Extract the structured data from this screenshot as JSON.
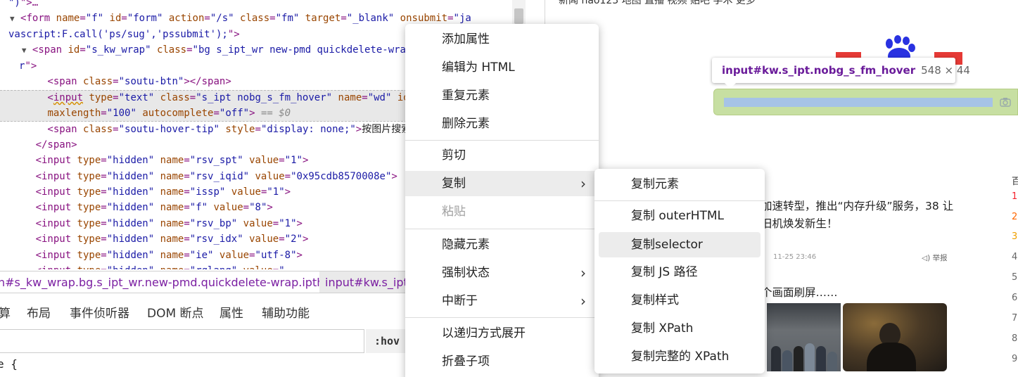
{
  "code_lines": [
    {
      "html": "<span class=\"av\">\")</span>\">…</a></span>"
    },
    {
      "html": "<span class=\"tri\">▼</span> &lt;form <span class=\"an\">name</span>=<span class=\"av\">\"f\"</span> <span class=\"an\">id</span>=<span class=\"av\">\"form\"</span> <span class=\"an\">action</span>=<span class=\"av\">\"/s\"</span> <span class=\"an\">class</span>=<span class=\"av\">\"fm\"</span> <span class=\"an\">target</span>=<span class=\"av\">\"_blank\"</span> <span class=\"an\">onsubmit</span>=<span class=\"av\">\"ja</span>"
    },
    {
      "html": "<span class=\"av\">vascript:F.call('ps/sug','pssubmit');</span>\">"
    },
    {
      "html": "  <span class=\"tri\">▼</span> &lt;span <span class=\"an\">id</span>=<span class=\"av\">\"s_kw_wrap\"</span> <span class=\"an\">class</span>=<span class=\"av\">\"bg s_ipt_wr new-pmd quickdelete-wrap ipthove</span>"
    },
    {
      "html": "<span class=\"av\">r</span>\">"
    },
    {
      "html": "        &lt;span <span class=\"an\">class</span>=<span class=\"av\">\"soutu-btn\"</span>&gt;&lt;/span&gt;"
    },
    {
      "html": "        &lt;<span class=\"sq\">input</span> <span class=\"an\">type</span>=<span class=\"av\">\"text\"</span> <span class=\"an\">class</span>=<span class=\"av\">\"s_ipt nobg_s_fm_hover\"</span> <span class=\"an\">name</span>=<span class=\"av\">\"wd\"</span> <span class=\"an\">id</span>=<span class=\"av\">\"kw\"</span>"
    },
    {
      "html": "        <span class=\"an\">maxlength</span>=<span class=\"av\">\"100\"</span> <span class=\"an\">autocomplete</span>=<span class=\"av\">\"off\"</span>&gt; <span class=\"dv\">== $0</span>"
    },
    {
      "html": "        &lt;span <span class=\"an\">class</span>=<span class=\"av\">\"soutu-hover-tip\"</span> <span class=\"an\">style</span>=<span class=\"av\">\"display: none;\"</span>&gt;<span class=\"tx\">按图片搜索</span>&lt;/span&gt;"
    },
    {
      "html": "      &lt;/span&gt;"
    },
    {
      "html": "      &lt;input <span class=\"an\">type</span>=<span class=\"av\">\"hidden\"</span> <span class=\"an\">name</span>=<span class=\"av\">\"rsv_spt\"</span> <span class=\"an\">value</span>=<span class=\"av\">\"1\"</span>&gt;"
    },
    {
      "html": "      &lt;input <span class=\"an\">type</span>=<span class=\"av\">\"hidden\"</span> <span class=\"an\">name</span>=<span class=\"av\">\"rsv_iqid\"</span> <span class=\"an\">value</span>=<span class=\"av\">\"0x95cdb8570008e\"</span>&gt;"
    },
    {
      "html": "      &lt;input <span class=\"an\">type</span>=<span class=\"av\">\"hidden\"</span> <span class=\"an\">name</span>=<span class=\"av\">\"issp\"</span> <span class=\"an\">value</span>=<span class=\"av\">\"1\"</span>&gt;"
    },
    {
      "html": "      &lt;input <span class=\"an\">type</span>=<span class=\"av\">\"hidden\"</span> <span class=\"an\">name</span>=<span class=\"av\">\"f\"</span> <span class=\"an\">value</span>=<span class=\"av\">\"8\"</span>&gt;"
    },
    {
      "html": "      &lt;input <span class=\"an\">type</span>=<span class=\"av\">\"hidden\"</span> <span class=\"an\">name</span>=<span class=\"av\">\"rsv_bp\"</span> <span class=\"an\">value</span>=<span class=\"av\">\"1\"</span>&gt;"
    },
    {
      "html": "      &lt;input <span class=\"an\">type</span>=<span class=\"av\">\"hidden\"</span> <span class=\"an\">name</span>=<span class=\"av\">\"rsv_idx\"</span> <span class=\"an\">value</span>=<span class=\"av\">\"2\"</span>&gt;"
    },
    {
      "html": "      &lt;input <span class=\"an\">type</span>=<span class=\"av\">\"hidden\"</span> <span class=\"an\">name</span>=<span class=\"av\">\"ie\"</span> <span class=\"an\">value</span>=<span class=\"av\">\"utf-8\"</span>&gt;"
    },
    {
      "html": "      &lt;input <span class=\"an\">type</span>=<span class=\"av\">\"hidden\"</span> <span class=\"an\">name</span>=<span class=\"av\">\"rqlang\"</span> <span class=\"an\">value</span>=<span class=\"av\">\"</span>"
    }
  ],
  "breadcrumb": {
    "item1": "n#s_kw_wrap.bg.s_ipt_wr.new-pmd.quickdelete-wrap.ipthover",
    "item2": "input#kw.s_ipt.n"
  },
  "sub_tabs": [
    "算",
    "布局",
    "事件侦听器",
    "DOM 断点",
    "属性",
    "辅助功能"
  ],
  "hov_label": ":hov",
  "style_rule": "e {",
  "context_menu": {
    "items": [
      {
        "label": "添加属性"
      },
      {
        "label": "编辑为 HTML"
      },
      {
        "label": "重复元素"
      },
      {
        "label": "删除元素"
      },
      {
        "label": "剪切"
      },
      {
        "label": "复制",
        "arrow": "›"
      },
      {
        "label": "粘贴"
      },
      {
        "label": "隐藏元素"
      },
      {
        "label": "强制状态",
        "arrow": "›"
      },
      {
        "label": "中断于",
        "arrow": "›"
      },
      {
        "label": "以递归方式展开"
      },
      {
        "label": "折叠子项"
      }
    ]
  },
  "copy_submenu": {
    "items": [
      {
        "label": "复制元素"
      },
      {
        "label": "复制 outerHTML"
      },
      {
        "label": "复制selector"
      },
      {
        "label": "复制 JS 路径"
      },
      {
        "label": "复制样式"
      },
      {
        "label": "复制 XPath"
      },
      {
        "label": "复制完整的 XPath"
      }
    ]
  },
  "inspect_tooltip": {
    "selector": "input#kw.s_ipt.nobg_s_fm_hover",
    "size": "548 × 44"
  },
  "page": {
    "top_nav": "新闻   hao123   地图   直播   视频   贴吧   学术   更多",
    "news_text": "加速转型，推出“内存升级”服务，38 让旧机焕发新生！",
    "news_meta": "11-25 23:46",
    "report_label": "举报",
    "news_2": "个画面刷屏……",
    "hotlist_header": "百",
    "hotlist_numbers": [
      "1",
      "2",
      "3",
      "4",
      "5",
      "6",
      "7",
      "8",
      "9"
    ]
  },
  "colors": {
    "hot_red": "#f5222d",
    "hot_orange": "#ff6600",
    "hot_amber": "#f0a000",
    "highlight_green": "#c7dfa2",
    "highlight_blue": "#a6c3e6"
  }
}
